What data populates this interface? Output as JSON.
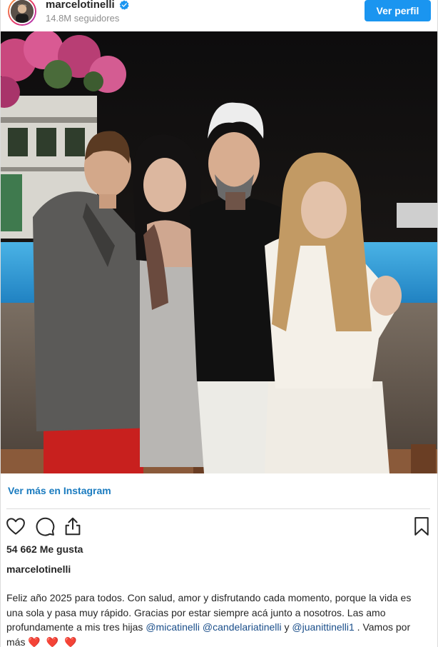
{
  "header": {
    "username": "marcelotinelli",
    "followers": "14.8M seguidores",
    "view_profile_label": "Ver perfil",
    "verified_color": "#1a95f0"
  },
  "photo": {
    "description_icon": "photo"
  },
  "view_more": "Ver más en Instagram",
  "actions": {
    "like_icon": "heart-icon",
    "comment_icon": "comment-icon",
    "share_icon": "share-icon",
    "save_icon": "bookmark-icon"
  },
  "likes": "54 662 Me gusta",
  "caption": {
    "username": "marcelotinelli",
    "text_1": "Feliz año 2025 para todos. Con salud, amor y disfrutando cada momento, porque la vida es una sola y pasa muy rápido. Gracias por estar siempre acá junto a nosotros. Las amo profundamente a mis tres hijas ",
    "mention_1": "@micatinelli",
    "mention_2": "@candelariatinelli",
    "text_2": " y ",
    "mention_3": "@juanittinelli1",
    "text_3": " . Vamos por más ",
    "hearts": "❤️ ❤️ ❤️"
  }
}
